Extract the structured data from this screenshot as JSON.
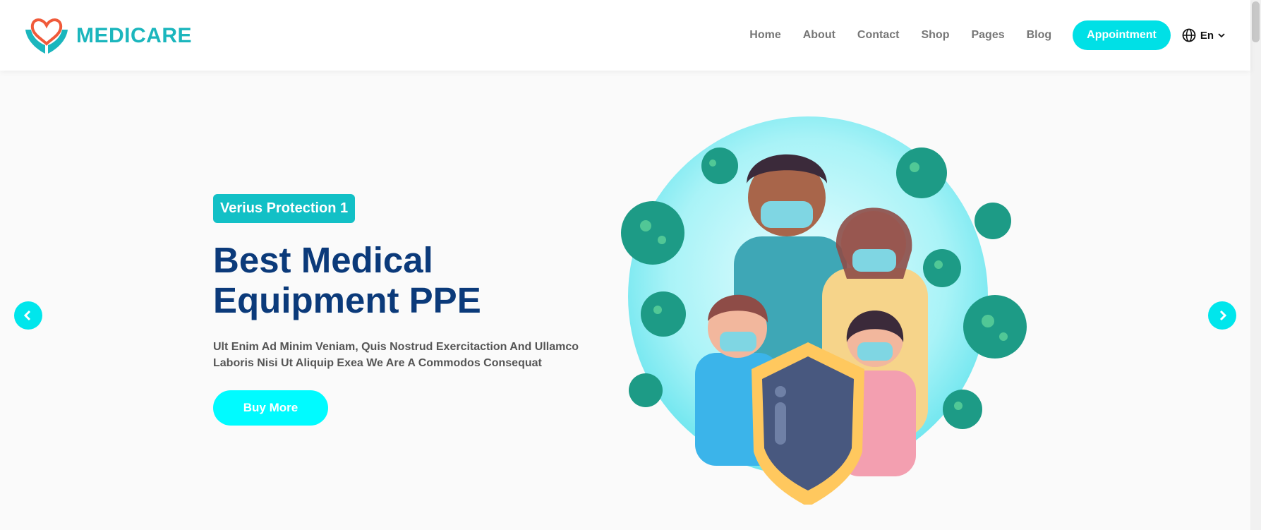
{
  "brand": {
    "name": "MEDICARE",
    "logo_icon": "heart-hands-icon"
  },
  "nav": {
    "items": [
      "Home",
      "About",
      "Contact",
      "Shop",
      "Pages",
      "Blog"
    ],
    "appointment_label": "Appointment",
    "language": "En"
  },
  "hero": {
    "badge": "Verius Protection 1",
    "title_line1": "Best Medical",
    "title_line2": "Equipment PPE",
    "description_line1": "Ult Enim Ad Minim Veniam, Quis Nostrud Exercitaction And Ullamco",
    "description_line2": "Laboris Nisi Ut Aliquip Exea We Are A Commodos Consequat",
    "cta_label": "Buy More"
  },
  "colors": {
    "accent": "#00e0e6",
    "brand": "#1bb6bd",
    "title": "#0b3a7a",
    "badge": "#12c0c6"
  }
}
